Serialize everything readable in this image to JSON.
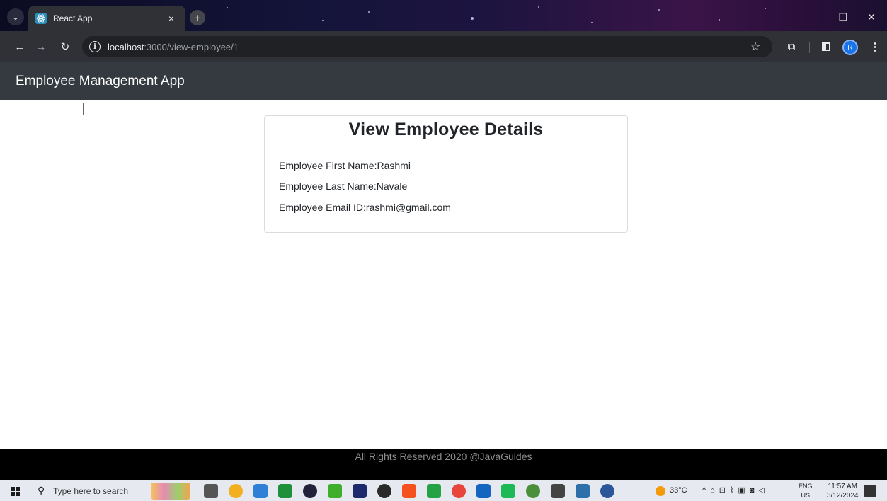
{
  "browser": {
    "tab_title": "React App",
    "tab_close": "×",
    "new_tab": "+",
    "url_host": "localhost",
    "url_path": ":3000/view-employee/1",
    "profile_initial": "R"
  },
  "app": {
    "brand": "Employee Management App"
  },
  "card": {
    "title": "View Employee Details",
    "first_name": "Employee First Name:Rashmi",
    "last_name": "Employee Last Name:Navale",
    "email": "Employee Email ID:rashmi@gmail.com"
  },
  "footer": {
    "text": "All Rights Reserved 2020 @JavaGuides"
  },
  "taskbar": {
    "search_placeholder": "Type here to search",
    "temperature": "33°C",
    "lang_line1": "ENG",
    "lang_line2": "US",
    "time": "11:57 AM",
    "date": "3/12/2024",
    "app_colors": [
      "#555555",
      "#f2b01e",
      "#2f7fd6",
      "#1f8f3a",
      "#22223b",
      "#3fae2a",
      "#1d2a6b",
      "#2a2a2a",
      "#f4511e",
      "#25a244",
      "#e8453c",
      "#1565c0",
      "#1db954",
      "#4c8f3a",
      "#444444",
      "#2d6fa8",
      "#2b579a"
    ]
  },
  "icons": {
    "tab_dropdown": "chevron-down-icon",
    "back": "arrow-left-icon",
    "forward": "arrow-right-icon",
    "reload": "reload-icon",
    "info": "info-icon",
    "bookmark": "star-icon",
    "extensions": "puzzle-icon",
    "side_panel": "side-panel-icon",
    "menu": "kebab-menu-icon"
  }
}
